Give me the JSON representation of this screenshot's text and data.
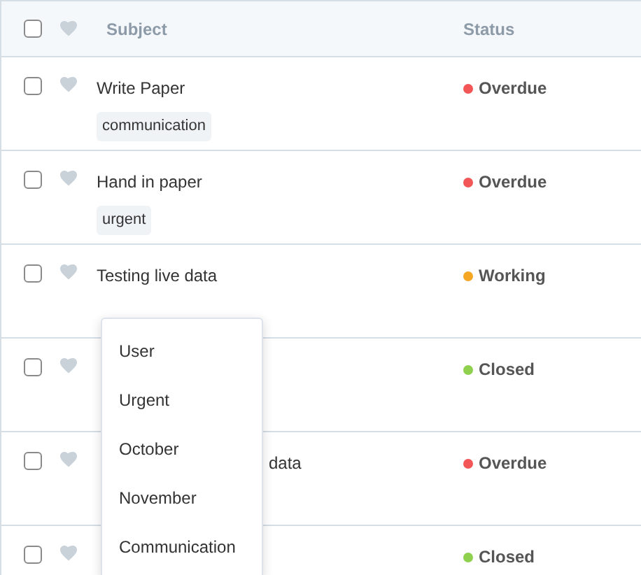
{
  "table": {
    "columns": [
      {
        "label": "Subject"
      },
      {
        "label": "Status"
      }
    ],
    "header_checkbox": {
      "checked": false
    },
    "rows": [
      {
        "checked": false,
        "favorite": false,
        "subject": "Write Paper",
        "tags": [
          "communication"
        ],
        "status": "Overdue",
        "color": "#f25656"
      },
      {
        "checked": false,
        "favorite": false,
        "subject": "Hand in paper",
        "tags": [
          "urgent"
        ],
        "status": "Overdue",
        "color": "#f25656"
      },
      {
        "checked": false,
        "favorite": false,
        "subject": "Testing live data",
        "status": "Working",
        "color": "#f5a623"
      },
      {
        "checked": false,
        "favorite": false,
        "status": "Closed",
        "color": "#8fd14f"
      },
      {
        "checked": false,
        "favorite": false,
        "subject_tail": "data",
        "status": "Overdue",
        "color": "#f25656"
      },
      {
        "checked": false,
        "favorite": false,
        "status": "Closed",
        "color": "#8fd14f"
      }
    ]
  },
  "dropdown": {
    "items": [
      "User",
      "Urgent",
      "October",
      "November",
      "Communication"
    ]
  }
}
